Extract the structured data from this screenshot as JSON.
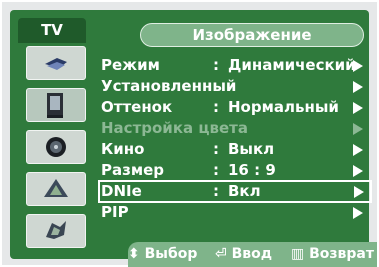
{
  "tab": {
    "label": "TV"
  },
  "header": {
    "title": "Изображение"
  },
  "sidebar": {
    "icons": [
      {
        "name": "antenna-icon",
        "active": false
      },
      {
        "name": "picture-icon",
        "active": true
      },
      {
        "name": "sound-icon",
        "active": false
      },
      {
        "name": "channel-icon",
        "active": false
      },
      {
        "name": "setup-icon",
        "active": false
      }
    ]
  },
  "menu": {
    "items": [
      {
        "label": "Режим",
        "colon": ":",
        "value": "Динамический",
        "disabled": false
      },
      {
        "label": "Установленный",
        "colon": "",
        "value": "",
        "disabled": false
      },
      {
        "label": "Оттенок",
        "colon": ":",
        "value": "Нормальный",
        "disabled": false
      },
      {
        "label": "Настройка цвета",
        "colon": "",
        "value": "",
        "disabled": true
      },
      {
        "label": "Кино",
        "colon": ":",
        "value": "Выкл",
        "disabled": false
      },
      {
        "label": "Размер",
        "colon": ":",
        "value": "16 : 9",
        "disabled": false
      },
      {
        "label": "DNIe",
        "colon": ":",
        "value": "Вкл",
        "disabled": false,
        "selected": true
      },
      {
        "label": "PIP",
        "colon": "",
        "value": "",
        "disabled": false
      }
    ]
  },
  "footer": {
    "select_label": "Выбор",
    "enter_label": "Ввод",
    "return_label": "Возврат"
  },
  "colors": {
    "panel": "#2f7a3c",
    "title_bar": "#7fb48a",
    "osd_frame": "#e6e8e9"
  }
}
